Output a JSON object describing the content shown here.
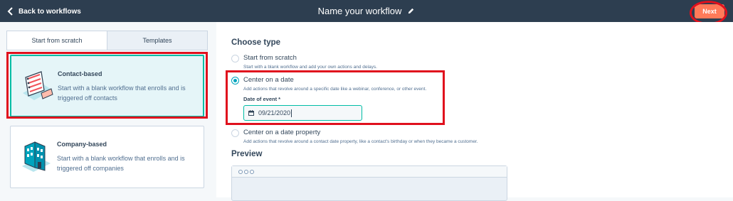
{
  "topbar": {
    "back_label": "Back to workflows",
    "workflow_title": "Name your workflow",
    "next_label": "Next"
  },
  "tabs": [
    {
      "label": "Start from scratch",
      "active": true
    },
    {
      "label": "Templates",
      "active": false
    }
  ],
  "cards": [
    {
      "title": "Contact-based",
      "description": "Start with a blank workflow that enrolls and is triggered off contacts",
      "selected": true,
      "icon": "contact-list-illustration"
    },
    {
      "title": "Company-based",
      "description": "Start with a blank workflow that enrolls and is triggered off companies",
      "selected": false,
      "icon": "building-illustration"
    }
  ],
  "main": {
    "choose_heading": "Choose type",
    "options": [
      {
        "label": "Start from scratch",
        "description": "Start with a blank workflow and add your own actions and delays.",
        "selected": false
      },
      {
        "label": "Center on a date",
        "description": "Add actions that revolve around a specific date like a webinar, conference, or other event.",
        "selected": true
      },
      {
        "label": "Center on a date property",
        "description": "Add actions that revolve around a contact date property, like a contact's birthday or when they became a customer.",
        "selected": false
      }
    ],
    "date_field_label": "Date of event *",
    "date_value": "09/21/2020",
    "preview_heading": "Preview"
  },
  "colors": {
    "topbar": "#2d3e50",
    "accent_orange": "#ff7a59",
    "selected_teal": "#00bda5",
    "radio_on": "#00a4bd",
    "annotation_red": "#e0101d"
  }
}
